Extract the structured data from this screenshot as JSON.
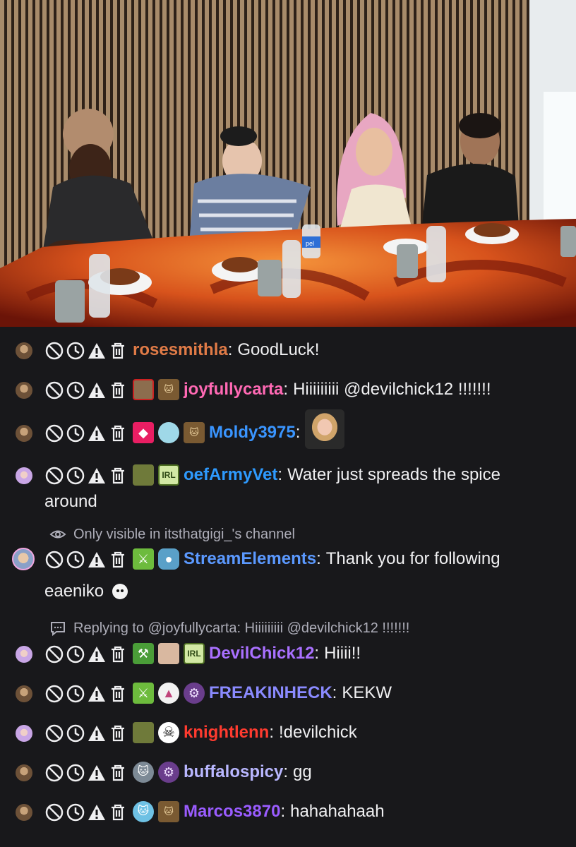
{
  "video": {
    "table_colors": {
      "cloth_dark": "#7a1a0a",
      "cloth_bright": "#f06a1c",
      "wall": "#b09478"
    }
  },
  "mod_icons": [
    "ban-icon",
    "timeout-icon",
    "warning-icon",
    "delete-icon"
  ],
  "colors": {
    "background": "#18181b",
    "text": "#efeff1",
    "notice_text": "#adadb8"
  },
  "messages": [
    {
      "avatar": "brown",
      "badges": [],
      "username": "rosesmithla",
      "username_color": "#e17b47",
      "text": "GoodLuck!"
    },
    {
      "avatar": "brown",
      "badges": [
        "photo-badge",
        "cat-badge"
      ],
      "username": "joyfullycarta",
      "username_color": "#ff69b4",
      "text": "Hiiiiiiiii @devilchick12 !!!!!!!"
    },
    {
      "avatar": "brown",
      "badges": [
        "gem-badge",
        "kitty-badge",
        "cat-badge"
      ],
      "username": "Moldy3975",
      "username_color": "#3a95ff",
      "text": ""
    },
    {
      "avatar": "purple",
      "badges": [
        "shrek-badge",
        "irl-badge"
      ],
      "username": "oefArmyVet",
      "username_color": "#2e9afe",
      "text": "Water just spreads the spice",
      "text_continued": "around"
    },
    {
      "notice": "Only visible in itsthatgigi_'s channel"
    },
    {
      "avatar": "ringed",
      "badges": [
        "sword-badge",
        "robot-badge"
      ],
      "username": "StreamElements",
      "username_color": "#5b99ff",
      "text": "Thank you for following",
      "text_continued": "eaeniko"
    },
    {
      "reply": "Replying to @joyfullycarta: Hiiiiiiiii @devilchick12 !!!!!!!"
    },
    {
      "avatar": "purple",
      "badges": [
        "hammer-badge",
        "girl-badge",
        "irl-badge"
      ],
      "username": "DevilChick12",
      "username_color": "#a970ff",
      "text": "Hiiii!!"
    },
    {
      "avatar": "brown",
      "badges": [
        "sword-badge",
        "dog-badge",
        "gear-badge"
      ],
      "username": "FREAKINHECK",
      "username_color": "#8a8aff",
      "text": "KEKW"
    },
    {
      "avatar": "purple",
      "badges": [
        "shrek-badge",
        "skull-badge"
      ],
      "username": "knightlenn",
      "username_color": "#ff3b2f",
      "text": "!devilchick"
    },
    {
      "avatar": "brown",
      "badges": [
        "greycat-badge",
        "gear-badge"
      ],
      "username": "buffalospicy",
      "username_color": "#b9b7ff",
      "text": "gg"
    },
    {
      "avatar": "brown",
      "badges": [
        "bluecat-badge",
        "cat-badge"
      ],
      "username": "Marcos3870",
      "username_color": "#9a5cff",
      "text": "hahahahaah"
    }
  ],
  "labels": {
    "irl": "IRL",
    "cup_brand": "pel"
  }
}
